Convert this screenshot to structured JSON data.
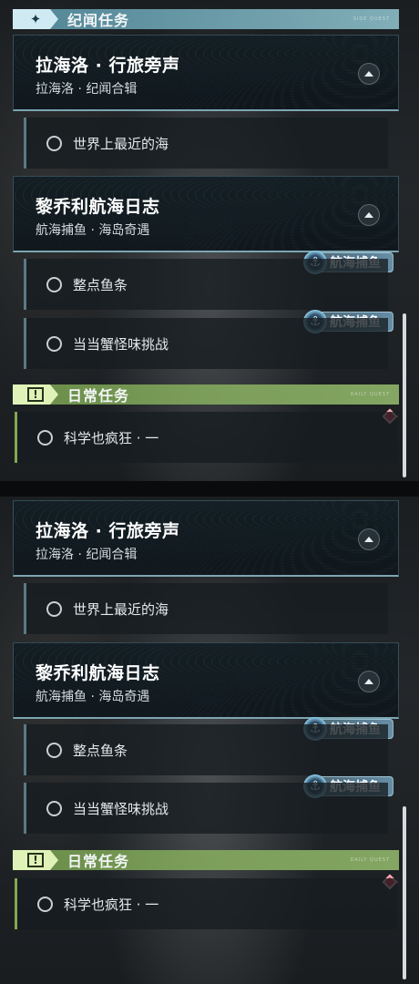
{
  "lore_section": {
    "title": "纪闻任务",
    "tiny_text": "SIDE QUEST"
  },
  "daily_section": {
    "title": "日常任务",
    "tiny_text": "DAILY QUEST"
  },
  "quest_1": {
    "title": "拉海洛 · 行旅旁声",
    "subtitle": "拉海洛 · 纪闻合辑",
    "objectives": [
      "世界上最近的海"
    ]
  },
  "quest_2": {
    "title": "黎乔利航海日志",
    "subtitle": "航海捕鱼 · 海岛奇遇",
    "objectives": [
      "整点鱼条",
      "当当蟹怪味挑战"
    ]
  },
  "daily_quest": {
    "objectives": [
      "科学也疯狂 · 一"
    ]
  },
  "tag_label": "航海捕鱼",
  "colors": {
    "lore_accent": "#8ec0cc",
    "daily_accent": "#a8c878",
    "alert": "#e0334a"
  },
  "icons": {
    "lore": "sparkle-icon",
    "daily": "exclamation-icon",
    "collapse": "chevron-up-icon",
    "fishing": "anchor-fish-icon"
  }
}
